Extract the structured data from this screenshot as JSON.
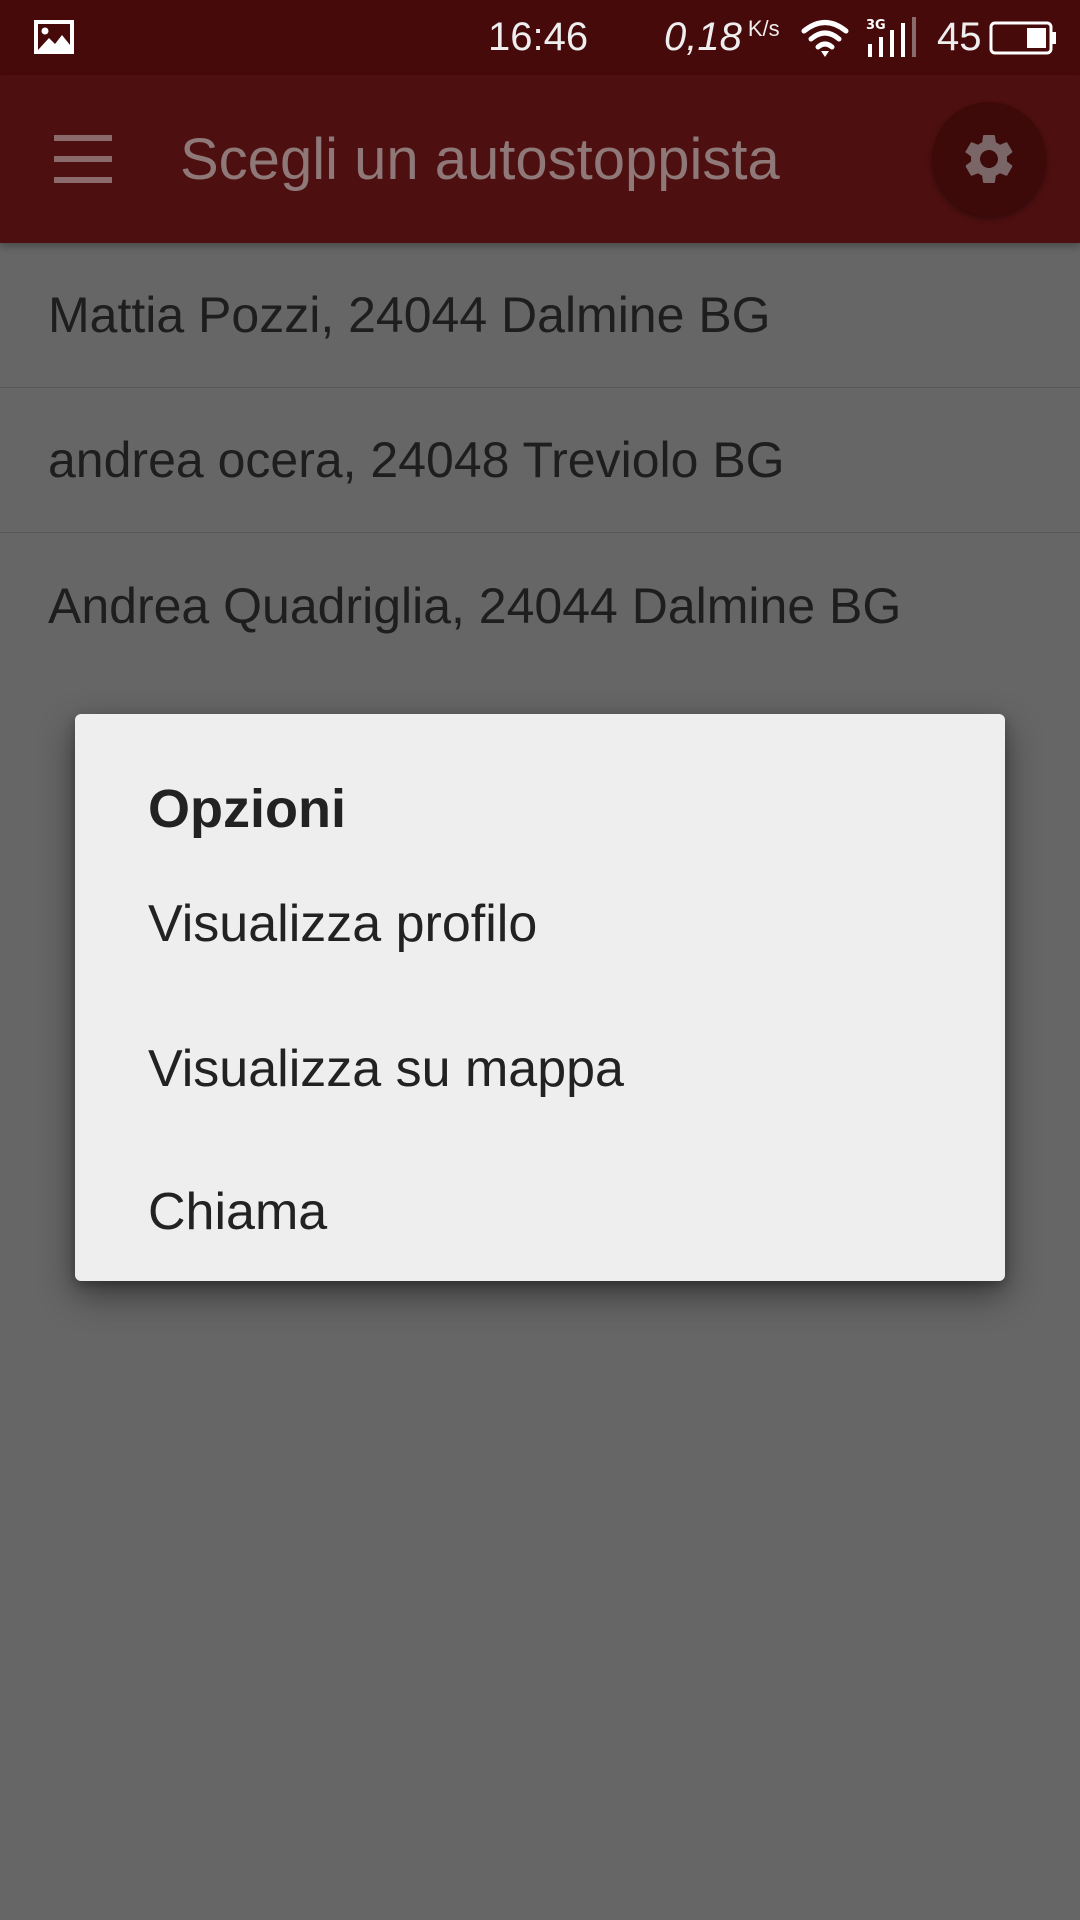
{
  "status_bar": {
    "time": "16:46",
    "net_speed": "0,18",
    "net_speed_unit": "K/s",
    "battery_level": "45",
    "icons": [
      "gallery-icon",
      "wifi-icon",
      "signal-3g-icon",
      "battery-icon"
    ],
    "network_type": "3G"
  },
  "app_bar": {
    "title": "Scegli un autostoppista",
    "menu_icon": "menu-icon",
    "settings_icon": "gear-icon"
  },
  "list": {
    "items": [
      {
        "label": "Mattia Pozzi, 24044 Dalmine BG"
      },
      {
        "label": "andrea ocera, 24048 Treviolo BG"
      },
      {
        "label": "Andrea Quadriglia, 24044 Dalmine BG"
      }
    ]
  },
  "dialog": {
    "title": "Opzioni",
    "options": [
      {
        "label": "Visualizza profilo"
      },
      {
        "label": "Visualizza su mappa"
      },
      {
        "label": "Chiama"
      }
    ]
  },
  "colors": {
    "status_bar": "#470a0b",
    "app_bar": "#4d0f10",
    "scrim_background": "#666666",
    "dialog_background": "#eeeeee",
    "text_dark": "#222222"
  }
}
